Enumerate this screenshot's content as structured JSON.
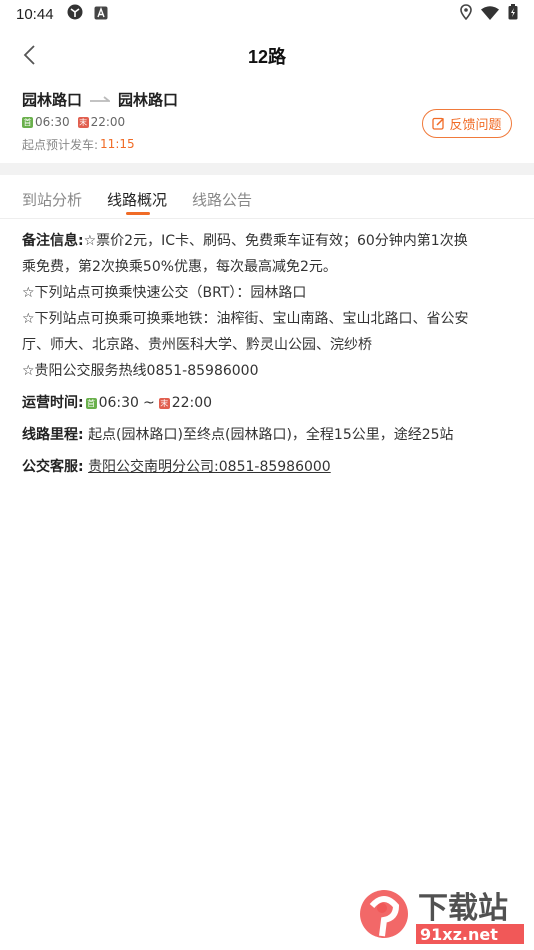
{
  "status_bar": {
    "time": "10:44",
    "icons": [
      "sync-icon",
      "a-badge-icon",
      "location-icon",
      "wifi-icon",
      "battery-icon"
    ]
  },
  "header": {
    "title": "12路"
  },
  "route": {
    "from": "园林路口",
    "to": "园林路口",
    "first_tag": "首",
    "first_time": "06:30",
    "last_tag": "末",
    "last_time": "22:00",
    "depart_label": "起点预计发车:",
    "depart_time": "11:15"
  },
  "feedback": {
    "label": "反馈问题"
  },
  "tabs": [
    {
      "label": "到站分析",
      "active": false
    },
    {
      "label": "线路概况",
      "active": true
    },
    {
      "label": "线路公告",
      "active": false
    }
  ],
  "overview": {
    "notes_label": "备注信息:",
    "notes_lines": [
      "☆票价2元，IC卡、刷码、免费乘车证有效；60分钟内第1次换",
      "乘免费，第2次换乘50%优惠，每次最高减免2元。",
      "☆下列站点可换乘快速公交（BRT）：园林路口",
      "☆下列站点可换乘可换乘地铁：油榨街、宝山南路、宝山北路口、省公安",
      "厅、师大、北京路、贵州医科大学、黔灵山公园、浣纱桥",
      "☆贵阳公交服务热线0851-85986000"
    ],
    "hours_label": "运营时间:",
    "hours_first_tag": "首",
    "hours_first": "06:30",
    "hours_sep": "~",
    "hours_last_tag": "末",
    "hours_last": "22:00",
    "mileage_label": "线路里程:",
    "mileage_text": "起点(园林路口)至终点(园林路口)，全程15公里，途经25站",
    "service_label": "公交客服:",
    "service_text": "贵阳公交南明分公司:0851-85986000"
  },
  "watermark": {
    "big": "下载站",
    "small": "91xz.net"
  },
  "colors": {
    "accent": "#f06b26",
    "start_tag": "#6ab04c",
    "end_tag": "#e15f4f"
  }
}
